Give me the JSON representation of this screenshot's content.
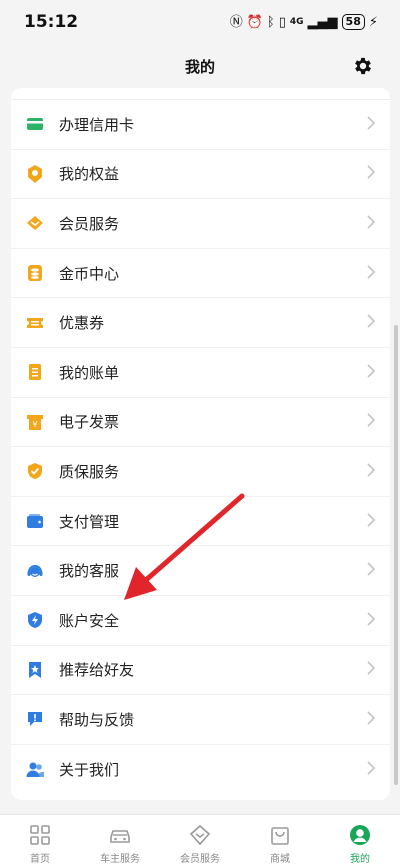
{
  "status_bar": {
    "time": "15:12",
    "network": "4G",
    "battery": "58"
  },
  "header": {
    "title": "我的"
  },
  "menu": [
    {
      "label": "办理信用卡",
      "icon": "credit-card-icon",
      "color": "#2cb36a"
    },
    {
      "label": "我的权益",
      "icon": "medal-icon",
      "color": "#f2a61a"
    },
    {
      "label": "会员服务",
      "icon": "diamond-icon",
      "color": "#f2a61a"
    },
    {
      "label": "金币中心",
      "icon": "coin-stack-icon",
      "color": "#f2a61a"
    },
    {
      "label": "优惠券",
      "icon": "ticket-icon",
      "color": "#f2a61a"
    },
    {
      "label": "我的账单",
      "icon": "bill-icon",
      "color": "#f2a61a"
    },
    {
      "label": "电子发票",
      "icon": "invoice-icon",
      "color": "#f2a61a"
    },
    {
      "label": "质保服务",
      "icon": "shield-check-icon",
      "color": "#f2a61a"
    },
    {
      "label": "支付管理",
      "icon": "wallet-icon",
      "color": "#2f7de1"
    },
    {
      "label": "我的客服",
      "icon": "headset-icon",
      "color": "#2f7de1"
    },
    {
      "label": "账户安全",
      "icon": "shield-bolt-icon",
      "color": "#2f7de1"
    },
    {
      "label": "推荐给好友",
      "icon": "bookmark-star-icon",
      "color": "#2f7de1"
    },
    {
      "label": "帮助与反馈",
      "icon": "feedback-icon",
      "color": "#2f7de1"
    },
    {
      "label": "关于我们",
      "icon": "users-icon",
      "color": "#2f7de1"
    }
  ],
  "tabbar": [
    {
      "label": "首页",
      "icon": "grid-icon",
      "active": false
    },
    {
      "label": "车主服务",
      "icon": "car-icon",
      "active": false
    },
    {
      "label": "会员服务",
      "icon": "diamond-outline-icon",
      "active": false
    },
    {
      "label": "商城",
      "icon": "shopping-bag-icon",
      "active": false
    },
    {
      "label": "我的",
      "icon": "profile-icon",
      "active": true
    }
  ],
  "colors": {
    "accent": "#1aa55a",
    "annotation_arrow": "#e0262a"
  }
}
